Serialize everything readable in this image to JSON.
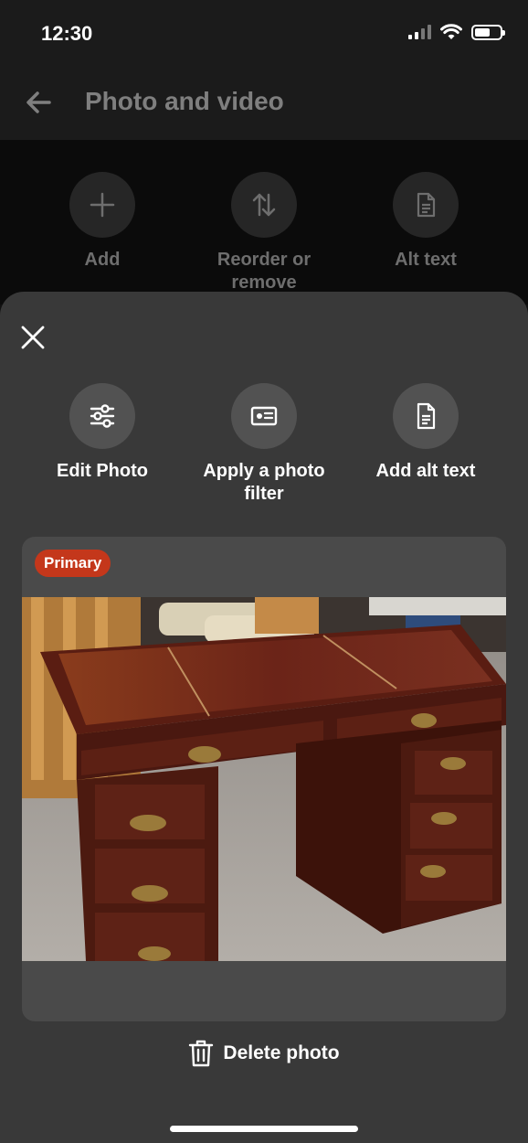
{
  "status_bar": {
    "time": "12:30",
    "icons": [
      "cellular-signal-icon",
      "wifi-icon",
      "battery-icon"
    ]
  },
  "header": {
    "title": "Photo and video",
    "back_icon": "arrow-left-icon"
  },
  "background_actions": [
    {
      "label": "Add",
      "icon": "plus-icon"
    },
    {
      "label": "Reorder or remove",
      "icon": "swap-vertical-icon"
    },
    {
      "label": "Alt text",
      "icon": "document-icon"
    }
  ],
  "sheet": {
    "close_icon": "close-icon",
    "actions": [
      {
        "label": "Edit Photo",
        "icon": "sliders-icon"
      },
      {
        "label": "Apply a photo filter",
        "icon": "id-card-icon"
      },
      {
        "label": "Add alt text",
        "icon": "document-icon"
      }
    ],
    "photo": {
      "badge": "Primary"
    },
    "delete_label": "Delete photo",
    "delete_icon": "trash-icon"
  },
  "colors": {
    "sheet_background": "#393939",
    "badge": "#c4371b",
    "dimmed_text": "#7f7f7f"
  }
}
